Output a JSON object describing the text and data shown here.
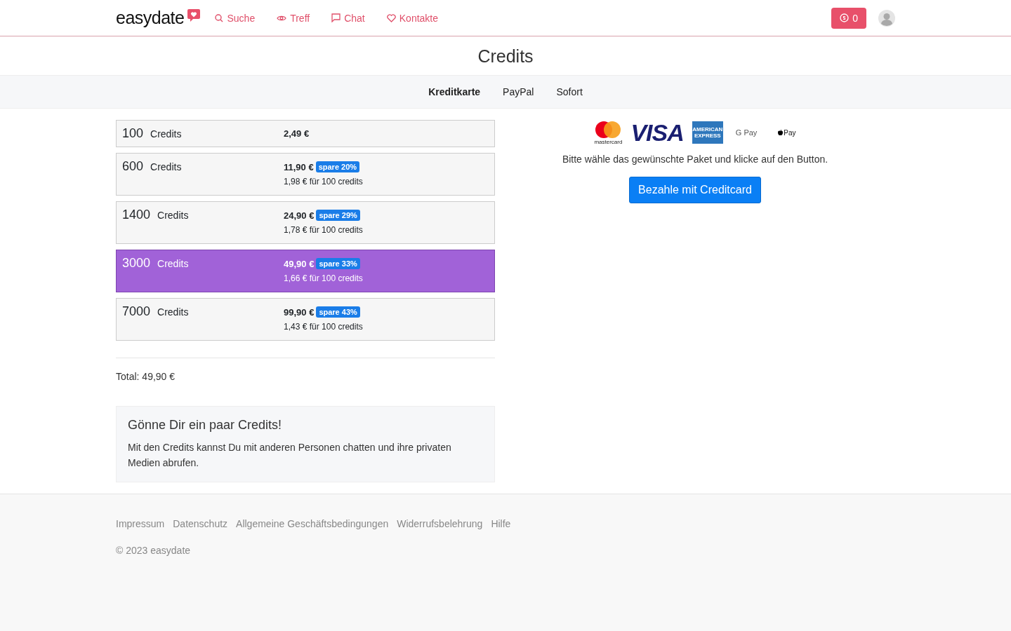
{
  "header": {
    "logo": "easydate",
    "nav": [
      {
        "kind": "search",
        "label": "Suche"
      },
      {
        "kind": "eye",
        "label": "Treff"
      },
      {
        "kind": "chat",
        "label": "Chat"
      },
      {
        "kind": "heart",
        "label": "Kontakte"
      }
    ],
    "credits_badge": "0"
  },
  "page_title": "Credits",
  "tabs": [
    {
      "label": "Kreditkarte",
      "selected": true
    },
    {
      "label": "PayPal",
      "selected": false
    },
    {
      "label": "Sofort",
      "selected": false
    }
  ],
  "packages": [
    {
      "amount": "100",
      "unit": "Credits",
      "price": "2,49 €",
      "selected": false
    },
    {
      "amount": "600",
      "unit": "Credits",
      "price": "11,90 €",
      "discount": "spare 20%",
      "per_100": "1,98 € für 100 credits",
      "selected": false
    },
    {
      "amount": "1400",
      "unit": "Credits",
      "price": "24,90 €",
      "discount": "spare 29%",
      "per_100": "1,78 € für 100 credits",
      "selected": false
    },
    {
      "amount": "3000",
      "unit": "Credits",
      "price": "49,90 €",
      "discount": "spare 33%",
      "per_100": "1,66 € für 100 credits",
      "selected": true
    },
    {
      "amount": "7000",
      "unit": "Credits",
      "price": "99,90 €",
      "discount": "spare 43%",
      "per_100": "1,43 € für 100 credits",
      "selected": false
    }
  ],
  "total": "Total: 49,90 €",
  "info_box": {
    "title": "Gönne Dir ein paar Credits!",
    "text": "Mit den Credits kannst Du mit anderen Personen chatten und ihre privaten Medien abrufen."
  },
  "payment_logos": [
    {
      "kind": "mastercard",
      "label": "mastercard"
    },
    {
      "kind": "visa",
      "label": "VISA"
    },
    {
      "kind": "amex",
      "label": "AMERICAN EXPRESS"
    },
    {
      "kind": "gpay",
      "label": "G Pay"
    },
    {
      "kind": "applepay",
      "label": "Pay"
    }
  ],
  "instruction": "Bitte wähle das gewünschte Paket und klicke auf den Button.",
  "pay_button": "Bezahle mit Creditcard",
  "footer": {
    "links": [
      "Impressum",
      "Datenschutz",
      "Allgemeine Geschäftsbedingungen",
      "Widerrufsbelehrung",
      "Hilfe"
    ],
    "copyright": "© 2023 easydate"
  }
}
